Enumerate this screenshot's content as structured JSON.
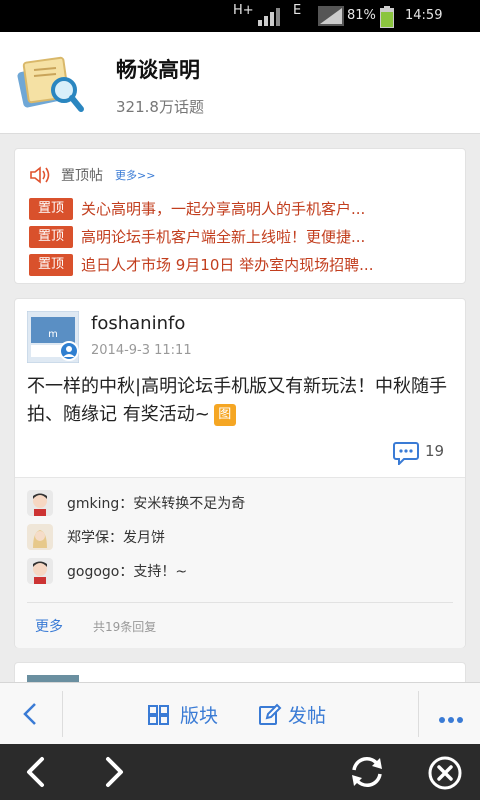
{
  "status_bar": {
    "network_type": "H+",
    "network_type2": "E",
    "battery": "81%",
    "time": "14:59"
  },
  "forum": {
    "name": "畅谈高明",
    "topic_count": "321.8万话题",
    "logo_icon": "scroll-magnifier-icon"
  },
  "pinned": {
    "label": "置顶帖",
    "more": "更多>>",
    "badge": "置顶",
    "items": [
      {
        "text": "关心高明事，一起分享高明人的手机客户..."
      },
      {
        "text": "高明论坛手机客户端全新上线啦！更便捷..."
      },
      {
        "text": "追日人才市场 9月10日 举办室内现场招聘..."
      }
    ]
  },
  "post": {
    "author": "foshaninfo",
    "time": "2014-9-3 11:11",
    "title": "不一样的中秋|高明论坛手机版又有新玩法！中秋随手拍、随缘记 有奖活动~",
    "image_tag": "图",
    "comment_count": "19",
    "replies": [
      {
        "user": "gmking",
        "text": "gmking：安米转换不足为奇"
      },
      {
        "user": "郑学保",
        "text": "郑学保：发月饼"
      },
      {
        "user": "gogogo",
        "text": "gogogo：支持！~"
      }
    ],
    "more_label": "更多",
    "reply_total": "共19条回复"
  },
  "toolbar": {
    "section_label": "版块",
    "post_label": "发帖"
  },
  "colors": {
    "accent": "#3a7bd5",
    "pin_badge": "#d9512c",
    "pin_text": "#c23e1e",
    "image_tag": "#f5a623"
  }
}
